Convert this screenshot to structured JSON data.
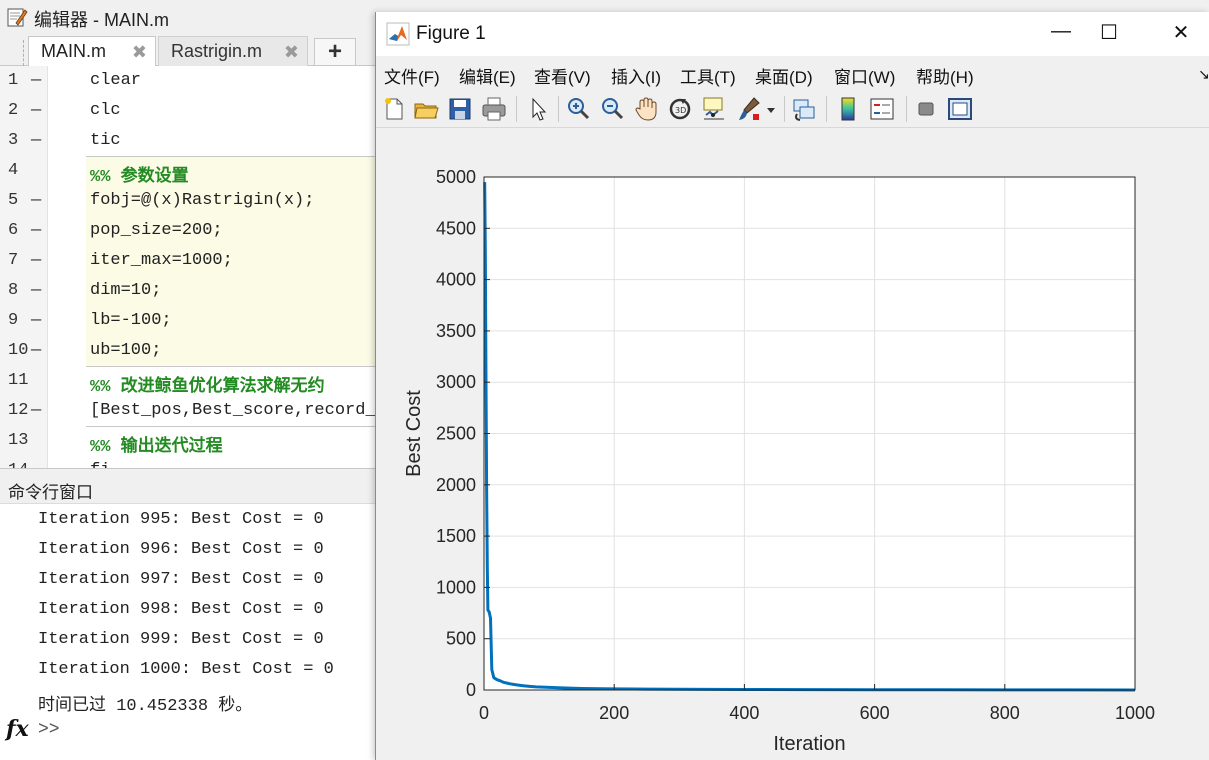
{
  "editor": {
    "title": "编辑器 - MAIN.m",
    "tabs": [
      {
        "label": "MAIN.m",
        "close": "✖"
      },
      {
        "label": "Rastrigin.m",
        "close": "✖"
      }
    ],
    "add_tab": "+",
    "lines": [
      {
        "num": "1",
        "dash": "—",
        "text": "clear"
      },
      {
        "num": "2",
        "dash": "—",
        "text": "clc"
      },
      {
        "num": "3",
        "dash": "—",
        "text": "tic"
      },
      {
        "num": "4",
        "dash": "",
        "text": "%% 参数设置"
      },
      {
        "num": "5",
        "dash": "—",
        "text": "fobj=@(x)Rastrigin(x);"
      },
      {
        "num": "6",
        "dash": "—",
        "text": "pop_size=200;"
      },
      {
        "num": "7",
        "dash": "—",
        "text": "iter_max=1000;"
      },
      {
        "num": "8",
        "dash": "—",
        "text": "dim=10;"
      },
      {
        "num": "9",
        "dash": "—",
        "text": "lb=-100;"
      },
      {
        "num": "10",
        "dash": "—",
        "text": "ub=100;"
      },
      {
        "num": "11",
        "dash": "",
        "text": "%% 改进鲸鱼优化算法求解无约"
      },
      {
        "num": "12",
        "dash": "—",
        "text": "[Best_pos,Best_score,record_B"
      },
      {
        "num": "13",
        "dash": "",
        "text": "%% 输出迭代过程"
      },
      {
        "num": "14",
        "dash": "—",
        "text": "fi"
      }
    ]
  },
  "command_window": {
    "title": "命令行窗口",
    "lines": [
      "Iteration 995: Best Cost = 0",
      "Iteration 996: Best Cost = 0",
      "Iteration 997: Best Cost = 0",
      "Iteration 998: Best Cost = 0",
      "Iteration 999: Best Cost = 0",
      "Iteration 1000: Best Cost = 0",
      "时间已过 10.452338 秒。"
    ],
    "fx": "fx",
    "prompt": ">>"
  },
  "figure": {
    "title": "Figure 1",
    "window_buttons": {
      "min": "—",
      "max": "☐",
      "close": "✕"
    },
    "menu": [
      "文件(F)",
      "编辑(E)",
      "查看(V)",
      "插入(I)",
      "工具(T)",
      "桌面(D)",
      "窗口(W)",
      "帮助(H)"
    ],
    "menu_expand": "↘",
    "toolbar_icons": [
      "new-figure",
      "open-file",
      "save",
      "print",
      "pointer",
      "zoom-in",
      "zoom-out",
      "pan",
      "rotate-3d",
      "data-cursor",
      "brush",
      "link-plot",
      "colorbar",
      "legend",
      "hide-plot-tools",
      "show-plot-tools"
    ]
  },
  "colors": {
    "line": "#0072bd",
    "comment": "#228b22",
    "cell_bg": "#fbfbe6"
  },
  "chart_data": {
    "type": "line",
    "title": "",
    "xlabel": "Iteration",
    "ylabel": "Best Cost",
    "xlim": [
      0,
      1000
    ],
    "ylim": [
      0,
      5000
    ],
    "xticks": [
      0,
      200,
      400,
      600,
      800,
      1000
    ],
    "yticks": [
      0,
      500,
      1000,
      1500,
      2000,
      2500,
      3000,
      3500,
      4000,
      4500,
      5000
    ],
    "grid": true,
    "series": [
      {
        "x": [
          1,
          2,
          3,
          4,
          5,
          6,
          8,
          10,
          12,
          15,
          20,
          25,
          30,
          40,
          50,
          60,
          70,
          80,
          100,
          120,
          150,
          200,
          250,
          300,
          400,
          500,
          600,
          700,
          800,
          900,
          1000
        ],
        "y": [
          4950,
          4300,
          3000,
          2000,
          1200,
          780,
          760,
          700,
          200,
          120,
          100,
          90,
          75,
          60,
          50,
          42,
          35,
          30,
          25,
          20,
          15,
          11,
          9,
          7,
          5,
          4,
          3,
          2,
          1,
          0.5,
          0
        ]
      }
    ]
  }
}
